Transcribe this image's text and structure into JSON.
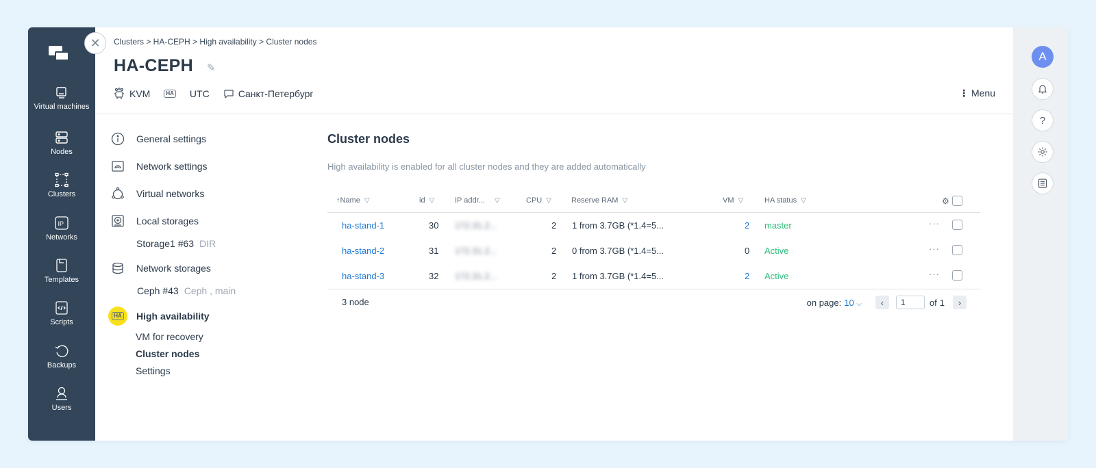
{
  "nav": {
    "items": [
      {
        "label": "Virtual machines",
        "icon": "virtual-machine-icon"
      },
      {
        "label": "Nodes",
        "icon": "server-icon"
      },
      {
        "label": "Clusters",
        "icon": "cluster-icon"
      },
      {
        "label": "Networks",
        "icon": "ip-icon"
      },
      {
        "label": "Templates",
        "icon": "template-icon"
      },
      {
        "label": "Scripts",
        "icon": "script-icon"
      },
      {
        "label": "Backups",
        "icon": "backup-icon"
      },
      {
        "label": "Users",
        "icon": "user-icon"
      }
    ]
  },
  "header": {
    "breadcrumb": "Clusters > HA-CEPH > High availability > Cluster nodes",
    "title": "HA-CEPH",
    "virtualization": "KVM",
    "ha_tag": "HA",
    "timezone": "UTC",
    "location": "Санкт-Петербург",
    "menu_label": "Menu"
  },
  "rail": {
    "avatar_letter": "A"
  },
  "settings_menu": {
    "general": "General settings",
    "network": "Network settings",
    "virtual_networks": "Virtual networks",
    "local_storages": "Local storages",
    "storage1": "Storage1 #63",
    "storage1_type": "DIR",
    "network_storages": "Network storages",
    "ceph": "Ceph #43",
    "ceph_type": "Ceph , main",
    "high_availability": "High availability",
    "vm_recovery": "VM for recovery",
    "cluster_nodes": "Cluster nodes",
    "settings": "Settings"
  },
  "main": {
    "title": "Cluster nodes",
    "description": "High availability is enabled for all cluster nodes and they are added automatically",
    "columns": {
      "name": "Name",
      "sort_arrow": "↑",
      "id": "id",
      "ip": "IP addr...",
      "cpu": "CPU",
      "ram": "Reserve RAM",
      "vm": "VM",
      "ha_status": "HA status"
    },
    "rows": [
      {
        "name": "ha-stand-1",
        "id": "30",
        "ip": "172.31.2...",
        "cpu": "2",
        "ram": "1 from 3.7GB (*1.4=5...",
        "vm": "2",
        "status": "master"
      },
      {
        "name": "ha-stand-2",
        "id": "31",
        "ip": "172.31.2...",
        "cpu": "2",
        "ram": "0 from 3.7GB (*1.4=5...",
        "vm": "0",
        "status": "Active"
      },
      {
        "name": "ha-stand-3",
        "id": "32",
        "ip": "172.31.2...",
        "cpu": "2",
        "ram": "1 from 3.7GB (*1.4=5...",
        "vm": "2",
        "status": "Active"
      }
    ],
    "footer": {
      "count": "3 node",
      "on_page_label": "on page:",
      "on_page_value": "10",
      "page": "1",
      "of_label": "of",
      "total_pages": "1"
    }
  },
  "colors": {
    "nav_bg": "#324559",
    "link": "#1e7ad6",
    "status_green": "#2dbe7a",
    "highlight": "#f8e11c",
    "avatar": "#6c8ff0"
  }
}
